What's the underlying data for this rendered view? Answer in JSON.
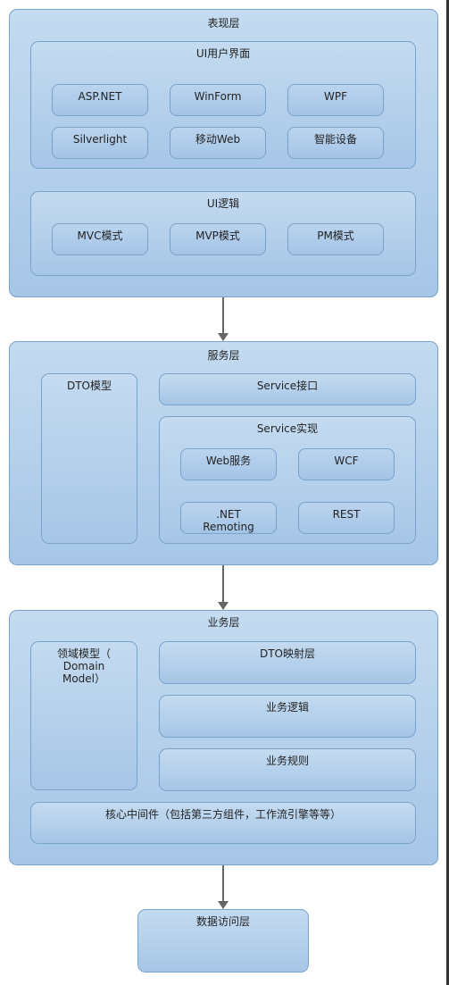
{
  "presentation": {
    "title": "表现层",
    "ui": {
      "title": "UI用户界面",
      "items": [
        "ASP.NET",
        "WinForm",
        "WPF",
        "Silverlight",
        "移动Web",
        "智能设备"
      ]
    },
    "logic": {
      "title": "UI逻辑",
      "items": [
        "MVC模式",
        "MVP模式",
        "PM模式"
      ]
    }
  },
  "service": {
    "title": "服务层",
    "dto": "DTO模型",
    "interface": "Service接口",
    "impl": {
      "title": "Service实现",
      "items": [
        "Web服务",
        "WCF",
        ".NET\nRemoting",
        "REST"
      ]
    }
  },
  "business": {
    "title": "业务层",
    "domain": "领域模型（\nDomain\nModel）",
    "items": [
      "DTO映射层",
      "业务逻辑",
      "业务规则"
    ],
    "middleware": "核心中间件（包括第三方组件，工作流引擎等等）"
  },
  "data": {
    "title": "数据访问层"
  },
  "colors": {
    "fill_top": "#c4dbf0",
    "fill_bottom": "#a6c6e7",
    "border": "#7aa3cc",
    "arrow": "#666666"
  }
}
